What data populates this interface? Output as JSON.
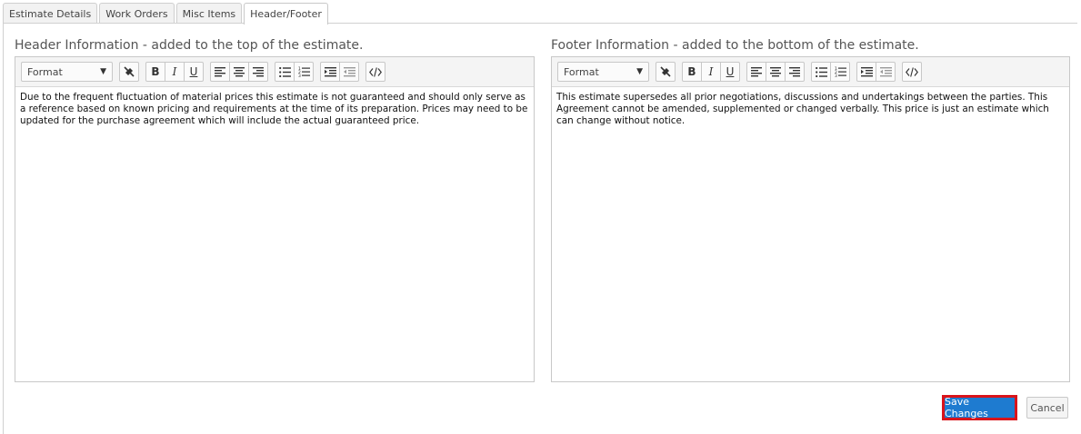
{
  "tabs": [
    {
      "label": "Estimate Details",
      "active": false
    },
    {
      "label": "Work Orders",
      "active": false
    },
    {
      "label": "Misc Items",
      "active": false
    },
    {
      "label": "Header/Footer",
      "active": true
    }
  ],
  "header_section": {
    "title": "Header Information - added to the top of the estimate.",
    "format_label": "Format",
    "content": "Due to the frequent fluctuation of material prices this estimate is not guaranteed and should only serve as a reference based on known pricing and requirements at the time of its preparation. Prices may need to be updated for the purchase agreement which will include the actual guaranteed price."
  },
  "footer_section": {
    "title": "Footer Information - added to the bottom of the estimate.",
    "format_label": "Format",
    "content": "This estimate supersedes all prior negotiations, discussions and undertakings between the parties. This Agreement cannot be amended, supplemented or changed verbally. This price is just an estimate which can change without notice."
  },
  "toolbar": {
    "bold": "B",
    "italic": "I",
    "underline": "U",
    "icons": [
      "clear-formatting-icon",
      "bold-icon",
      "italic-icon",
      "underline-icon",
      "align-left-icon",
      "align-center-icon",
      "align-right-icon",
      "bullet-list-icon",
      "numbered-list-icon",
      "indent-icon",
      "outdent-icon",
      "code-view-icon"
    ]
  },
  "actions": {
    "save_label": "Save Changes",
    "cancel_label": "Cancel"
  },
  "colors": {
    "save_bg": "#1e7bd0",
    "save_highlight": "#d9141b"
  }
}
